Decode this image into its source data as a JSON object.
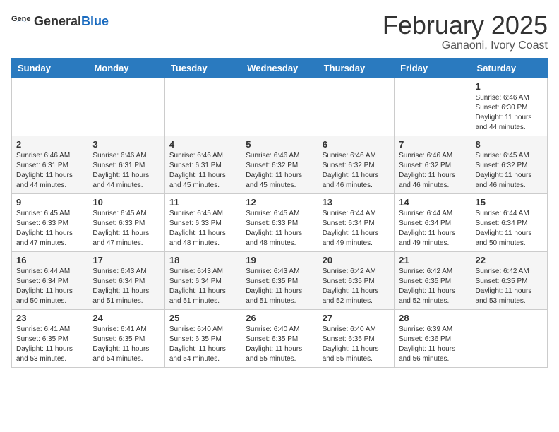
{
  "header": {
    "logo_general": "General",
    "logo_blue": "Blue",
    "title": "February 2025",
    "subtitle": "Ganaoni, Ivory Coast"
  },
  "weekdays": [
    "Sunday",
    "Monday",
    "Tuesday",
    "Wednesday",
    "Thursday",
    "Friday",
    "Saturday"
  ],
  "weeks": [
    [
      {
        "day": "",
        "info": ""
      },
      {
        "day": "",
        "info": ""
      },
      {
        "day": "",
        "info": ""
      },
      {
        "day": "",
        "info": ""
      },
      {
        "day": "",
        "info": ""
      },
      {
        "day": "",
        "info": ""
      },
      {
        "day": "1",
        "info": "Sunrise: 6:46 AM\nSunset: 6:30 PM\nDaylight: 11 hours and 44 minutes."
      }
    ],
    [
      {
        "day": "2",
        "info": "Sunrise: 6:46 AM\nSunset: 6:31 PM\nDaylight: 11 hours and 44 minutes."
      },
      {
        "day": "3",
        "info": "Sunrise: 6:46 AM\nSunset: 6:31 PM\nDaylight: 11 hours and 44 minutes."
      },
      {
        "day": "4",
        "info": "Sunrise: 6:46 AM\nSunset: 6:31 PM\nDaylight: 11 hours and 45 minutes."
      },
      {
        "day": "5",
        "info": "Sunrise: 6:46 AM\nSunset: 6:32 PM\nDaylight: 11 hours and 45 minutes."
      },
      {
        "day": "6",
        "info": "Sunrise: 6:46 AM\nSunset: 6:32 PM\nDaylight: 11 hours and 46 minutes."
      },
      {
        "day": "7",
        "info": "Sunrise: 6:46 AM\nSunset: 6:32 PM\nDaylight: 11 hours and 46 minutes."
      },
      {
        "day": "8",
        "info": "Sunrise: 6:45 AM\nSunset: 6:32 PM\nDaylight: 11 hours and 46 minutes."
      }
    ],
    [
      {
        "day": "9",
        "info": "Sunrise: 6:45 AM\nSunset: 6:33 PM\nDaylight: 11 hours and 47 minutes."
      },
      {
        "day": "10",
        "info": "Sunrise: 6:45 AM\nSunset: 6:33 PM\nDaylight: 11 hours and 47 minutes."
      },
      {
        "day": "11",
        "info": "Sunrise: 6:45 AM\nSunset: 6:33 PM\nDaylight: 11 hours and 48 minutes."
      },
      {
        "day": "12",
        "info": "Sunrise: 6:45 AM\nSunset: 6:33 PM\nDaylight: 11 hours and 48 minutes."
      },
      {
        "day": "13",
        "info": "Sunrise: 6:44 AM\nSunset: 6:34 PM\nDaylight: 11 hours and 49 minutes."
      },
      {
        "day": "14",
        "info": "Sunrise: 6:44 AM\nSunset: 6:34 PM\nDaylight: 11 hours and 49 minutes."
      },
      {
        "day": "15",
        "info": "Sunrise: 6:44 AM\nSunset: 6:34 PM\nDaylight: 11 hours and 50 minutes."
      }
    ],
    [
      {
        "day": "16",
        "info": "Sunrise: 6:44 AM\nSunset: 6:34 PM\nDaylight: 11 hours and 50 minutes."
      },
      {
        "day": "17",
        "info": "Sunrise: 6:43 AM\nSunset: 6:34 PM\nDaylight: 11 hours and 51 minutes."
      },
      {
        "day": "18",
        "info": "Sunrise: 6:43 AM\nSunset: 6:34 PM\nDaylight: 11 hours and 51 minutes."
      },
      {
        "day": "19",
        "info": "Sunrise: 6:43 AM\nSunset: 6:35 PM\nDaylight: 11 hours and 51 minutes."
      },
      {
        "day": "20",
        "info": "Sunrise: 6:42 AM\nSunset: 6:35 PM\nDaylight: 11 hours and 52 minutes."
      },
      {
        "day": "21",
        "info": "Sunrise: 6:42 AM\nSunset: 6:35 PM\nDaylight: 11 hours and 52 minutes."
      },
      {
        "day": "22",
        "info": "Sunrise: 6:42 AM\nSunset: 6:35 PM\nDaylight: 11 hours and 53 minutes."
      }
    ],
    [
      {
        "day": "23",
        "info": "Sunrise: 6:41 AM\nSunset: 6:35 PM\nDaylight: 11 hours and 53 minutes."
      },
      {
        "day": "24",
        "info": "Sunrise: 6:41 AM\nSunset: 6:35 PM\nDaylight: 11 hours and 54 minutes."
      },
      {
        "day": "25",
        "info": "Sunrise: 6:40 AM\nSunset: 6:35 PM\nDaylight: 11 hours and 54 minutes."
      },
      {
        "day": "26",
        "info": "Sunrise: 6:40 AM\nSunset: 6:35 PM\nDaylight: 11 hours and 55 minutes."
      },
      {
        "day": "27",
        "info": "Sunrise: 6:40 AM\nSunset: 6:35 PM\nDaylight: 11 hours and 55 minutes."
      },
      {
        "day": "28",
        "info": "Sunrise: 6:39 AM\nSunset: 6:36 PM\nDaylight: 11 hours and 56 minutes."
      },
      {
        "day": "",
        "info": ""
      }
    ]
  ]
}
